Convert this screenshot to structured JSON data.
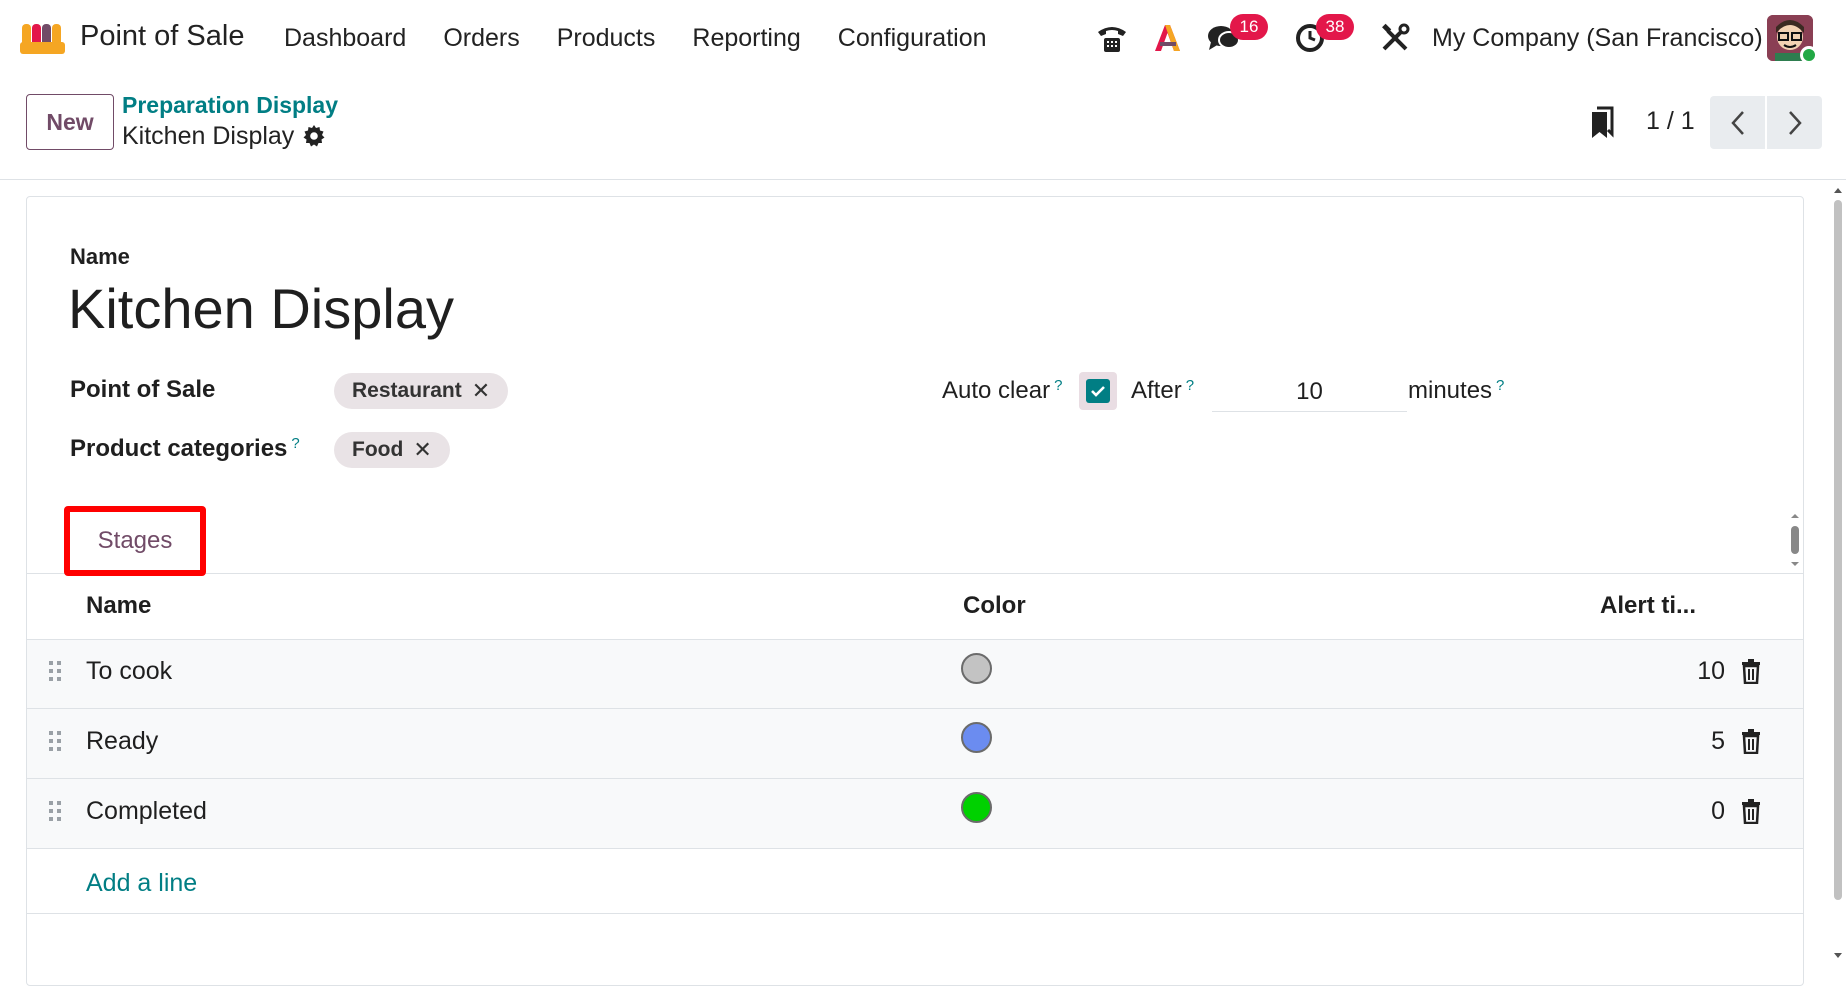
{
  "navbar": {
    "app_name": "Point of Sale",
    "menu": [
      "Dashboard",
      "Orders",
      "Products",
      "Reporting",
      "Configuration"
    ],
    "messages_count": "16",
    "activities_count": "38",
    "company": "My Company (San Francisco)"
  },
  "control": {
    "new_label": "New",
    "breadcrumb_parent": "Preparation Display",
    "breadcrumb_current": "Kitchen Display",
    "pager": "1 / 1"
  },
  "form": {
    "name_label": "Name",
    "name_value": "Kitchen Display",
    "pos_label": "Point of Sale",
    "pos_tag": "Restaurant",
    "categories_label": "Product categories",
    "categories_tag": "Food",
    "help_mark": "?",
    "auto_clear_label": "Auto clear",
    "auto_clear_checked": true,
    "after_label": "After",
    "after_value": "10",
    "minutes_label": "minutes",
    "tag_remove": "✕"
  },
  "tabs": {
    "stages": "Stages"
  },
  "table": {
    "columns": [
      "Name",
      "Color",
      "Alert ti..."
    ],
    "rows": [
      {
        "name": "To cook",
        "color": "#c3c3c3",
        "alert": "10"
      },
      {
        "name": "Ready",
        "color": "#6b8cf0",
        "alert": "5"
      },
      {
        "name": "Completed",
        "color": "#00d100",
        "alert": "0"
      }
    ],
    "add_line": "Add a line"
  }
}
